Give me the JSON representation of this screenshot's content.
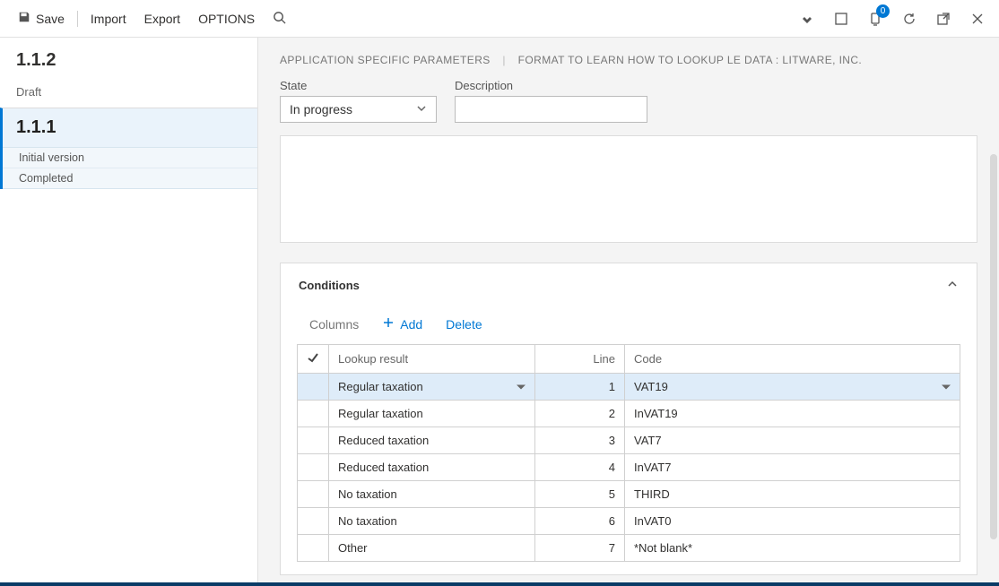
{
  "toolbar": {
    "save": "Save",
    "import": "Import",
    "export": "Export",
    "options": "OPTIONS",
    "notif_count": "0"
  },
  "sidebar": {
    "versions": [
      {
        "title": "1.1.2",
        "sub": "Draft",
        "selected": false,
        "meta": []
      },
      {
        "title": "1.1.1",
        "sub": "",
        "selected": true,
        "meta": [
          "Initial version",
          "Completed"
        ]
      }
    ]
  },
  "breadcrumb": {
    "a": "APPLICATION SPECIFIC PARAMETERS",
    "b": "FORMAT TO LEARN HOW TO LOOKUP LE DATA : LITWARE, INC."
  },
  "form": {
    "state_label": "State",
    "state_value": "In progress",
    "desc_label": "Description",
    "desc_value": ""
  },
  "conditions": {
    "title": "Conditions",
    "columns_label": "Columns",
    "add_label": "Add",
    "delete_label": "Delete",
    "headers": {
      "lookup": "Lookup result",
      "line": "Line",
      "code": "Code"
    },
    "rows": [
      {
        "lookup": "Regular taxation",
        "line": "1",
        "code": "VAT19",
        "selected": true
      },
      {
        "lookup": "Regular taxation",
        "line": "2",
        "code": "InVAT19",
        "selected": false
      },
      {
        "lookup": "Reduced taxation",
        "line": "3",
        "code": "VAT7",
        "selected": false
      },
      {
        "lookup": "Reduced taxation",
        "line": "4",
        "code": "InVAT7",
        "selected": false
      },
      {
        "lookup": "No taxation",
        "line": "5",
        "code": "THIRD",
        "selected": false
      },
      {
        "lookup": "No taxation",
        "line": "6",
        "code": "InVAT0",
        "selected": false
      },
      {
        "lookup": "Other",
        "line": "7",
        "code": "*Not blank*",
        "selected": false
      }
    ]
  }
}
